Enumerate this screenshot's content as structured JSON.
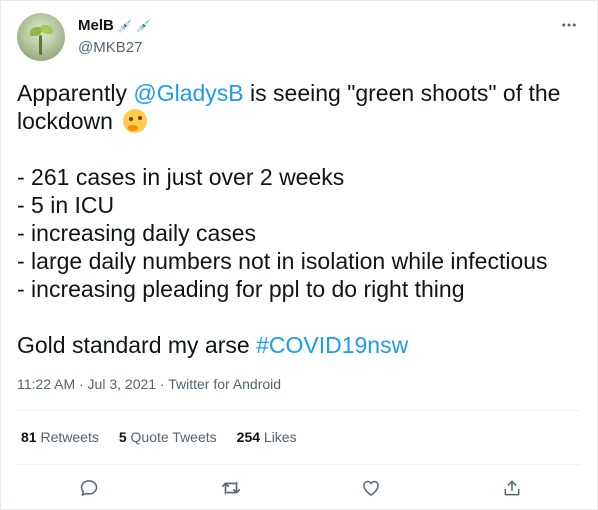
{
  "author": {
    "display_name": "MelB",
    "handle": "@MKB27",
    "name_badges": "💉 💉"
  },
  "tweet": {
    "text_parts": {
      "p1_pre": "Apparently ",
      "p1_mention": "@GladysB",
      "p1_post": " is seeing \"green shoots\" of the",
      "p2": "lockdown",
      "b1": "- 261 cases in just over 2 weeks",
      "b2": "- 5 in ICU",
      "b3": "- increasing daily cases",
      "b4": "- large daily numbers not in isolation while infectious",
      "b5": "- increasing pleading for ppl to do right thing",
      "p3_pre": "Gold standard my arse ",
      "p3_hashtag": "#COVID19nsw"
    },
    "emoji": "thinking-face",
    "timestamp": "11:22 AM · Jul 3, 2021 · Twitter for Android"
  },
  "stats": {
    "retweets_count": "81",
    "retweets_label": "Retweets",
    "quotes_count": "5",
    "quotes_label": "Quote Tweets",
    "likes_count": "254",
    "likes_label": "Likes"
  },
  "icons": {
    "more": "more-horizontal-icon",
    "reply": "reply-icon",
    "retweet": "retweet-icon",
    "like": "heart-icon",
    "share": "share-icon"
  },
  "colors": {
    "link": "#1d9bf0",
    "secondary_text": "#536471",
    "primary_text": "#0f1419"
  }
}
